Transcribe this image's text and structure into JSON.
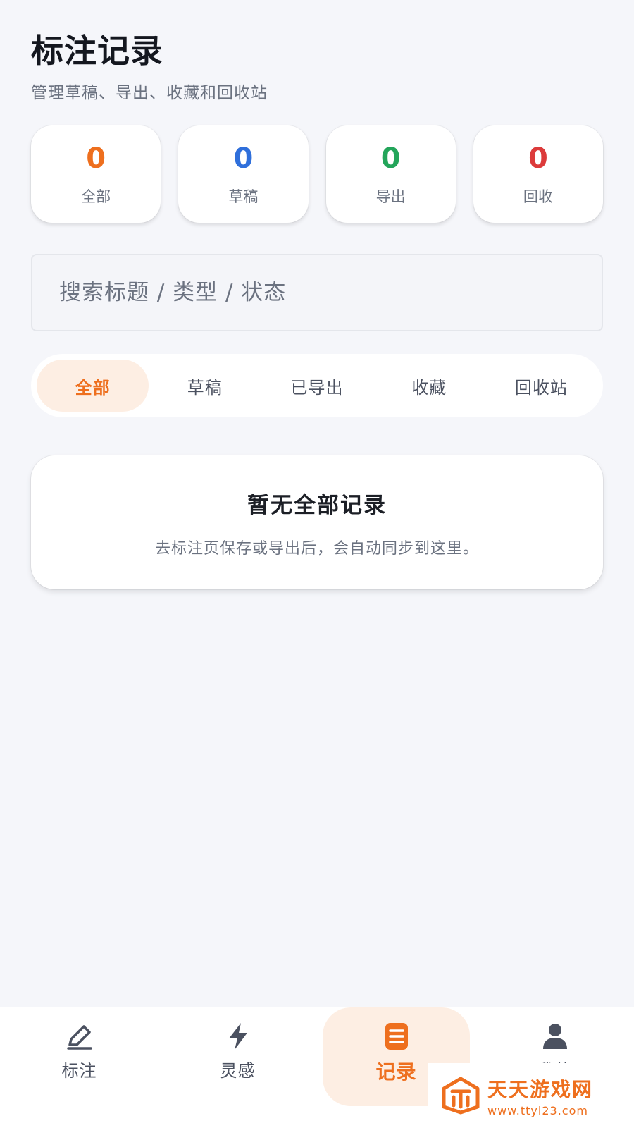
{
  "header": {
    "title": "标注记录",
    "subtitle": "管理草稿、导出、收藏和回收站"
  },
  "stats": [
    {
      "value": "0",
      "label": "全部",
      "color": "#ee6f1e"
    },
    {
      "value": "0",
      "label": "草稿",
      "color": "#2f6fdb"
    },
    {
      "value": "0",
      "label": "导出",
      "color": "#23a55a"
    },
    {
      "value": "0",
      "label": "回收",
      "color": "#dc3b3b"
    }
  ],
  "search": {
    "placeholder": "搜索标题 / 类型 / 状态",
    "value": ""
  },
  "tabs": [
    {
      "label": "全部",
      "active": true
    },
    {
      "label": "草稿",
      "active": false
    },
    {
      "label": "已导出",
      "active": false
    },
    {
      "label": "收藏",
      "active": false
    },
    {
      "label": "回收站",
      "active": false
    }
  ],
  "empty_state": {
    "title": "暂无全部记录",
    "description": "去标注页保存或导出后，会自动同步到这里。"
  },
  "bottom_nav": [
    {
      "label": "标注",
      "icon": "pencil-icon",
      "active": false
    },
    {
      "label": "灵感",
      "icon": "lightning-icon",
      "active": false
    },
    {
      "label": "记录",
      "icon": "list-icon",
      "active": true
    },
    {
      "label": "我的",
      "icon": "user-icon",
      "active": false
    }
  ],
  "watermark": {
    "text": "天天游戏网",
    "url": "www.ttyl23.com"
  },
  "colors": {
    "accent": "#ee6f1e",
    "accent_soft": "#fdeee3",
    "background": "#f5f6fa"
  }
}
